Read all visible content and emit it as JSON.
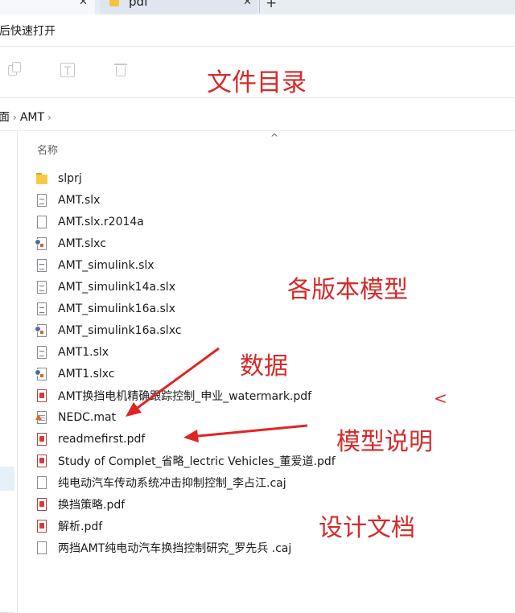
{
  "tabs": [
    {
      "label": ""
    },
    {
      "label": "pdf"
    }
  ],
  "quick_access": {
    "label": "后快速打开"
  },
  "toolbar": {
    "rename_glyph": "T"
  },
  "annotations": {
    "file_directory": "文件目录",
    "model_versions": "各版本模型",
    "data": "数据",
    "model_readme": "模型说明",
    "design_docs": "设计文档",
    "stray_mark": "<"
  },
  "breadcrumb": {
    "root": "面",
    "folder": "AMT"
  },
  "columns": {
    "name": "名称"
  },
  "files": [
    {
      "name": "slprj",
      "type": "folder"
    },
    {
      "name": "AMT.slx",
      "type": "slx"
    },
    {
      "name": "AMT.slx.r2014a",
      "type": "file"
    },
    {
      "name": "AMT.slxc",
      "type": "slxc"
    },
    {
      "name": "AMT_simulink.slx",
      "type": "slx"
    },
    {
      "name": "AMT_simulink14a.slx",
      "type": "slx"
    },
    {
      "name": "AMT_simulink16a.slx",
      "type": "slx"
    },
    {
      "name": "AMT_simulink16a.slxc",
      "type": "slxc"
    },
    {
      "name": "AMT1.slx",
      "type": "slx"
    },
    {
      "name": "AMT1.slxc",
      "type": "slxc"
    },
    {
      "name": "AMT换挡电机精确跟踪控制_申业_watermark.pdf",
      "type": "pdf"
    },
    {
      "name": "NEDC.mat",
      "type": "mat"
    },
    {
      "name": "readmefirst.pdf",
      "type": "pdf"
    },
    {
      "name": "Study of Complet_省略_lectric Vehicles_董爱道.pdf",
      "type": "pdf"
    },
    {
      "name": "纯电动汽车传动系统冲击抑制控制_李占江.caj",
      "type": "file"
    },
    {
      "name": "换挡策略.pdf",
      "type": "pdf"
    },
    {
      "name": "解析.pdf",
      "type": "pdf"
    },
    {
      "name": "两挡AMT纯电动汽车换挡控制研究_罗先兵 .caj",
      "type": "file"
    }
  ],
  "colors": {
    "annotation": "#d62a2a",
    "folder": "#f7c948",
    "pdf": "#d63a3a"
  }
}
